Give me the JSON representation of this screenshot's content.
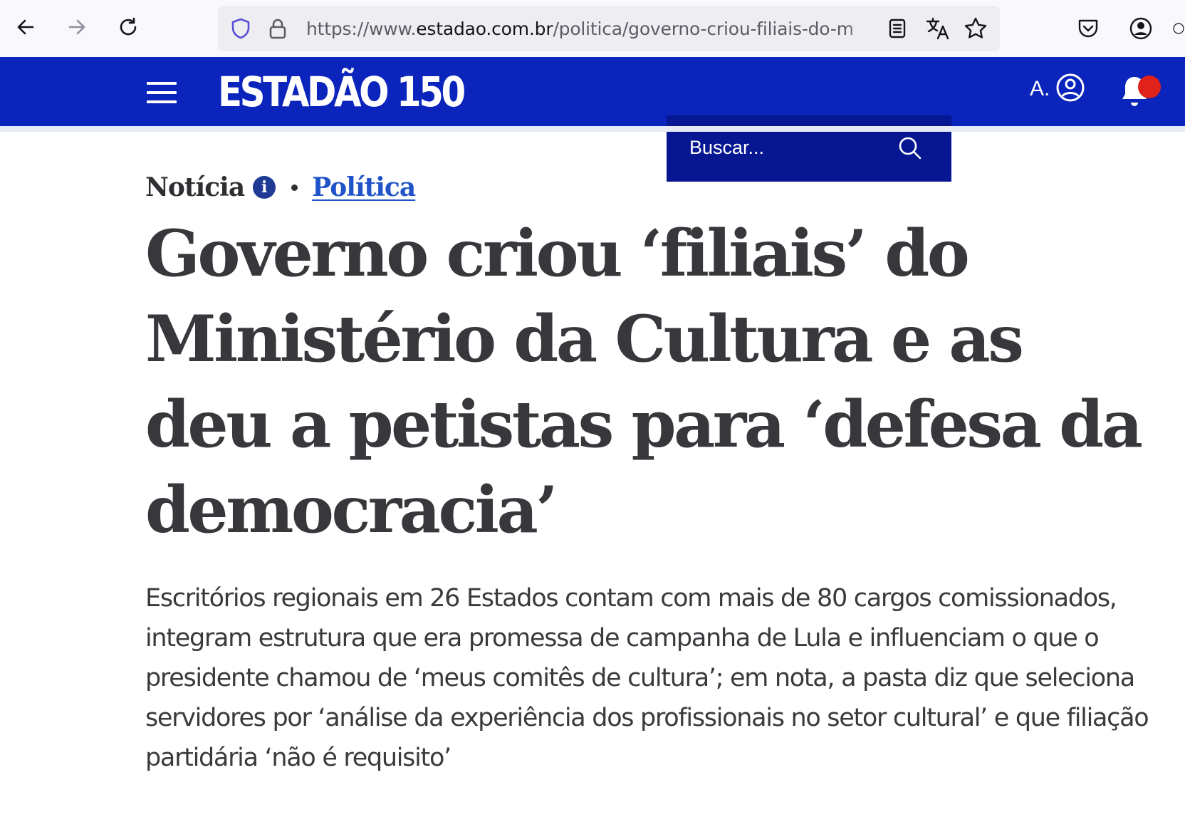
{
  "browser": {
    "url_prefix": "https://www.",
    "url_host": "estadao.com.br",
    "url_path": "/politica/governo-criou-filiais-do-m"
  },
  "site": {
    "logo": "ESTADÃO 150",
    "search_placeholder": "Buscar...",
    "user_initial": "A."
  },
  "article": {
    "type": "Notícia",
    "section": "Política",
    "headline": "Governo criou ‘filiais’ do Ministério da Cultura e as deu a petistas para ‘defesa da democracia’",
    "deck": "Escritórios regionais em 26 Estados contam com mais de 80 cargos comissionados, integram estrutura que era promessa de campanha de Lula e influenciam o que o presidente chamou de ‘meus comitês de cultura’; em nota, a pasta diz que seleciona servidores por ‘análise da experiência dos profissionais no setor cultural’ e que filiação partidária ‘não é requisito’"
  },
  "colors": {
    "header": "#0a24bc",
    "search_bg": "#061791",
    "section_link": "#2154c8",
    "notification_dot": "#e0221c"
  },
  "icons": [
    "back-icon",
    "forward-icon",
    "reload-icon",
    "shield-icon",
    "lock-icon",
    "reader-view-icon",
    "translate-icon",
    "bookmark-star-icon",
    "pocket-icon",
    "account-icon",
    "menu-icon",
    "search-icon",
    "user-icon",
    "bell-icon",
    "info-icon"
  ]
}
